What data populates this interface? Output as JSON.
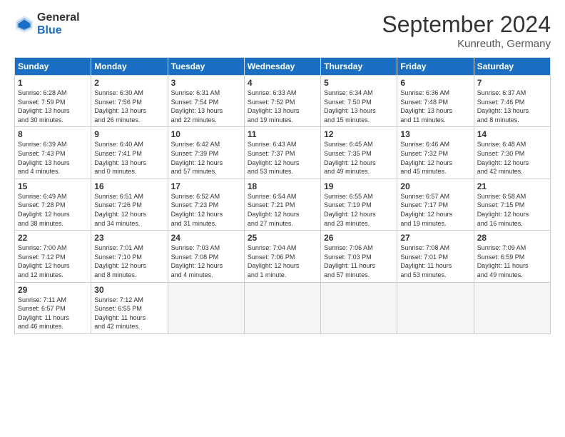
{
  "header": {
    "title": "September 2024",
    "location": "Kunreuth, Germany",
    "logo_general": "General",
    "logo_blue": "Blue"
  },
  "days_of_week": [
    "Sunday",
    "Monday",
    "Tuesday",
    "Wednesday",
    "Thursday",
    "Friday",
    "Saturday"
  ],
  "weeks": [
    [
      {
        "day": "1",
        "info": "Sunrise: 6:28 AM\nSunset: 7:59 PM\nDaylight: 13 hours\nand 30 minutes."
      },
      {
        "day": "2",
        "info": "Sunrise: 6:30 AM\nSunset: 7:56 PM\nDaylight: 13 hours\nand 26 minutes."
      },
      {
        "day": "3",
        "info": "Sunrise: 6:31 AM\nSunset: 7:54 PM\nDaylight: 13 hours\nand 22 minutes."
      },
      {
        "day": "4",
        "info": "Sunrise: 6:33 AM\nSunset: 7:52 PM\nDaylight: 13 hours\nand 19 minutes."
      },
      {
        "day": "5",
        "info": "Sunrise: 6:34 AM\nSunset: 7:50 PM\nDaylight: 13 hours\nand 15 minutes."
      },
      {
        "day": "6",
        "info": "Sunrise: 6:36 AM\nSunset: 7:48 PM\nDaylight: 13 hours\nand 11 minutes."
      },
      {
        "day": "7",
        "info": "Sunrise: 6:37 AM\nSunset: 7:46 PM\nDaylight: 13 hours\nand 8 minutes."
      }
    ],
    [
      {
        "day": "8",
        "info": "Sunrise: 6:39 AM\nSunset: 7:43 PM\nDaylight: 13 hours\nand 4 minutes."
      },
      {
        "day": "9",
        "info": "Sunrise: 6:40 AM\nSunset: 7:41 PM\nDaylight: 13 hours\nand 0 minutes."
      },
      {
        "day": "10",
        "info": "Sunrise: 6:42 AM\nSunset: 7:39 PM\nDaylight: 12 hours\nand 57 minutes."
      },
      {
        "day": "11",
        "info": "Sunrise: 6:43 AM\nSunset: 7:37 PM\nDaylight: 12 hours\nand 53 minutes."
      },
      {
        "day": "12",
        "info": "Sunrise: 6:45 AM\nSunset: 7:35 PM\nDaylight: 12 hours\nand 49 minutes."
      },
      {
        "day": "13",
        "info": "Sunrise: 6:46 AM\nSunset: 7:32 PM\nDaylight: 12 hours\nand 45 minutes."
      },
      {
        "day": "14",
        "info": "Sunrise: 6:48 AM\nSunset: 7:30 PM\nDaylight: 12 hours\nand 42 minutes."
      }
    ],
    [
      {
        "day": "15",
        "info": "Sunrise: 6:49 AM\nSunset: 7:28 PM\nDaylight: 12 hours\nand 38 minutes."
      },
      {
        "day": "16",
        "info": "Sunrise: 6:51 AM\nSunset: 7:26 PM\nDaylight: 12 hours\nand 34 minutes."
      },
      {
        "day": "17",
        "info": "Sunrise: 6:52 AM\nSunset: 7:23 PM\nDaylight: 12 hours\nand 31 minutes."
      },
      {
        "day": "18",
        "info": "Sunrise: 6:54 AM\nSunset: 7:21 PM\nDaylight: 12 hours\nand 27 minutes."
      },
      {
        "day": "19",
        "info": "Sunrise: 6:55 AM\nSunset: 7:19 PM\nDaylight: 12 hours\nand 23 minutes."
      },
      {
        "day": "20",
        "info": "Sunrise: 6:57 AM\nSunset: 7:17 PM\nDaylight: 12 hours\nand 19 minutes."
      },
      {
        "day": "21",
        "info": "Sunrise: 6:58 AM\nSunset: 7:15 PM\nDaylight: 12 hours\nand 16 minutes."
      }
    ],
    [
      {
        "day": "22",
        "info": "Sunrise: 7:00 AM\nSunset: 7:12 PM\nDaylight: 12 hours\nand 12 minutes."
      },
      {
        "day": "23",
        "info": "Sunrise: 7:01 AM\nSunset: 7:10 PM\nDaylight: 12 hours\nand 8 minutes."
      },
      {
        "day": "24",
        "info": "Sunrise: 7:03 AM\nSunset: 7:08 PM\nDaylight: 12 hours\nand 4 minutes."
      },
      {
        "day": "25",
        "info": "Sunrise: 7:04 AM\nSunset: 7:06 PM\nDaylight: 12 hours\nand 1 minute."
      },
      {
        "day": "26",
        "info": "Sunrise: 7:06 AM\nSunset: 7:03 PM\nDaylight: 11 hours\nand 57 minutes."
      },
      {
        "day": "27",
        "info": "Sunrise: 7:08 AM\nSunset: 7:01 PM\nDaylight: 11 hours\nand 53 minutes."
      },
      {
        "day": "28",
        "info": "Sunrise: 7:09 AM\nSunset: 6:59 PM\nDaylight: 11 hours\nand 49 minutes."
      }
    ],
    [
      {
        "day": "29",
        "info": "Sunrise: 7:11 AM\nSunset: 6:57 PM\nDaylight: 11 hours\nand 46 minutes."
      },
      {
        "day": "30",
        "info": "Sunrise: 7:12 AM\nSunset: 6:55 PM\nDaylight: 11 hours\nand 42 minutes."
      },
      {
        "day": "",
        "info": ""
      },
      {
        "day": "",
        "info": ""
      },
      {
        "day": "",
        "info": ""
      },
      {
        "day": "",
        "info": ""
      },
      {
        "day": "",
        "info": ""
      }
    ]
  ]
}
